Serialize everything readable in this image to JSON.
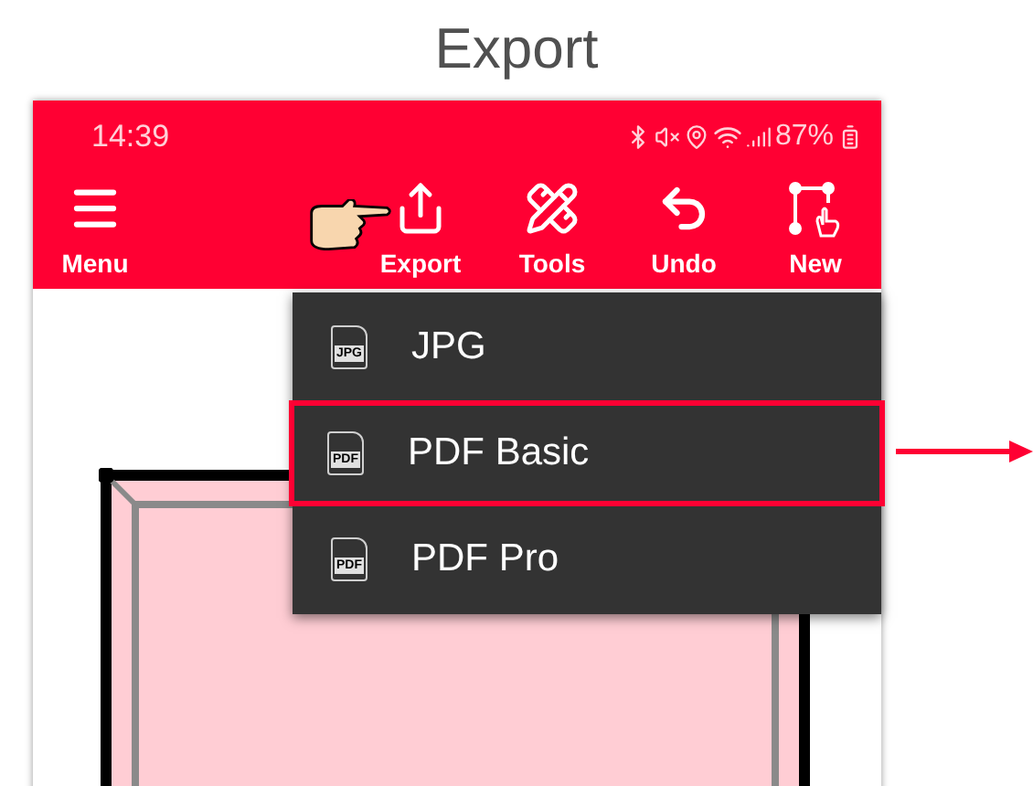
{
  "page_title": "Export",
  "status_bar": {
    "time": "14:39",
    "battery": "87%"
  },
  "toolbar": [
    {
      "label": "Menu",
      "kind": "menu",
      "pointed": false
    },
    {
      "label": "Export",
      "kind": "export",
      "pointed": true
    },
    {
      "label": "Tools",
      "kind": "tools",
      "pointed": false
    },
    {
      "label": "Undo",
      "kind": "undo",
      "pointed": false
    },
    {
      "label": "New",
      "kind": "new",
      "pointed": false
    }
  ],
  "export_menu": [
    {
      "label": "JPG",
      "icon_label": "JPG",
      "selected": false
    },
    {
      "label": "PDF Basic",
      "icon_label": "PDF",
      "selected": true
    },
    {
      "label": "PDF Pro",
      "icon_label": "PDF",
      "selected": false
    }
  ]
}
